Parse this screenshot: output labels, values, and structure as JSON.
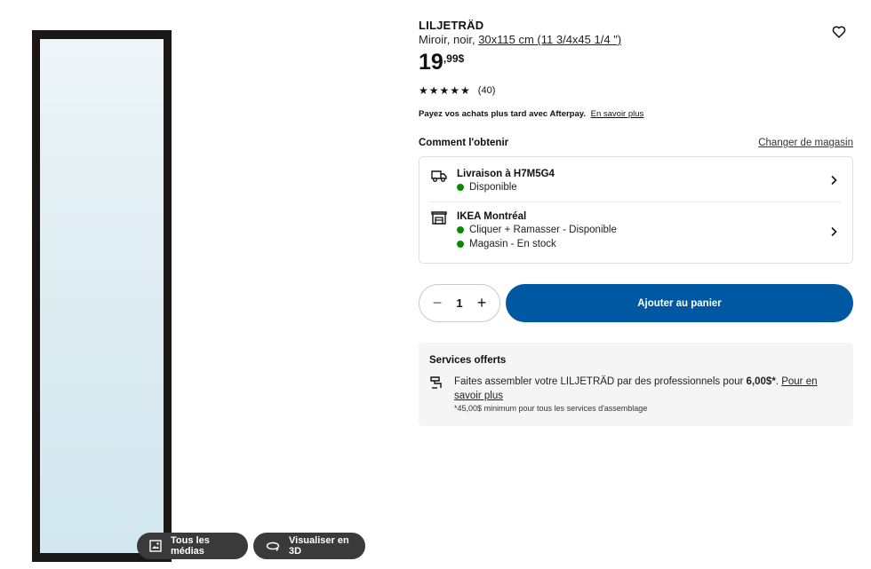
{
  "product": {
    "name": "LILJETRÄD",
    "description": "Miroir, noir, ",
    "size": "30x115 cm (11 3/4x45 1/4 \")",
    "price_main": "19",
    "price_cents": ",99$",
    "stars": "★★★★★",
    "review_count": "(40)"
  },
  "afterpay": {
    "text": "Payez vos achats plus tard avec Afterpay.",
    "link": "En savoir plus"
  },
  "fulfillment": {
    "title": "Comment l'obtenir",
    "change_store": "Changer de magasin",
    "delivery": {
      "title": "Livraison à H7M5G4",
      "status": "Disponible"
    },
    "store": {
      "title": "IKEA Montréal",
      "status1": "Cliquer + Ramasser - Disponible",
      "status2": "Magasin - En stock"
    }
  },
  "cart": {
    "quantity": "1",
    "minus": "−",
    "plus": "+",
    "add_label": "Ajouter au panier"
  },
  "services": {
    "title": "Services offerts",
    "text_before": "Faites assembler votre LILJETRÄD par des professionnels pour ",
    "price": "6,00$*",
    "text_after": ". ",
    "link": "Pour en savoir plus",
    "note": "*45,00$ minimum pour tous les services d'assemblage"
  },
  "media": {
    "all_media": "Tous les médias",
    "view_3d": "Visualiser en 3D"
  },
  "colors": {
    "accent": "#0058a3",
    "available": "#0a8a00",
    "frame": "#1b1715"
  },
  "icons": [
    "heart-icon",
    "star-icon",
    "truck-icon",
    "store-icon",
    "chevron-right-icon",
    "minus-icon",
    "plus-icon",
    "assembly-icon",
    "image-icon",
    "rotate-3d-icon"
  ]
}
